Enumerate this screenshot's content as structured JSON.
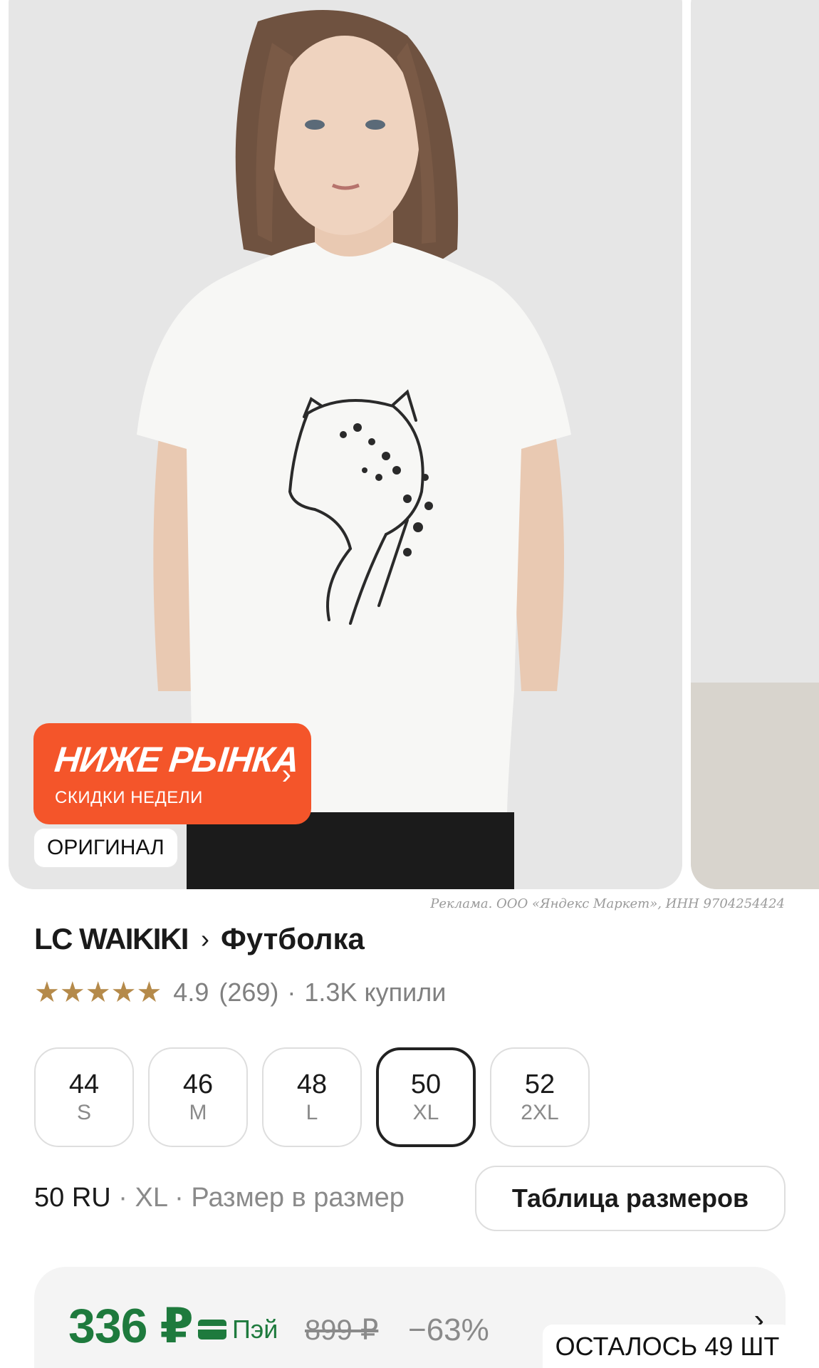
{
  "promo": {
    "title": "НИЖЕ РЫНКА",
    "subtitle": "СКИДКИ НЕДЕЛИ"
  },
  "badge": "ОРИГИНАЛ",
  "ad_disclaimer": "Реклама. ООО «Яндекс Маркет», ИНН 9704254424",
  "breadcrumb": {
    "brand": "LC WAIKIKI",
    "product": "Футболка"
  },
  "rating": {
    "stars": "★★★★★",
    "value": "4.9",
    "reviews": "(269)",
    "separator": "·",
    "bought": "1.3K купили"
  },
  "sizes": [
    {
      "ru": "44",
      "intl": "S",
      "selected": false
    },
    {
      "ru": "46",
      "intl": "M",
      "selected": false
    },
    {
      "ru": "48",
      "intl": "L",
      "selected": false
    },
    {
      "ru": "50",
      "intl": "XL",
      "selected": true
    },
    {
      "ru": "52",
      "intl": "2XL",
      "selected": false
    }
  ],
  "size_info": {
    "selected": "50 RU",
    "intl": "XL",
    "fit": "Размер в размер",
    "dot": "·"
  },
  "size_table_button": "Таблица размеров",
  "price": {
    "current": "336 ₽",
    "pay_label": "Пэй",
    "old": "899 ₽",
    "discount": "−63%",
    "chevron": "›"
  },
  "stock": "ОСТАЛОСЬ 49 ШТ",
  "colors": {
    "promo": "#f4552a",
    "price_green": "#1e7a3d",
    "star": "#b58a4a"
  },
  "icons": {
    "promo_chevron": "chevron-right-icon",
    "crumb_chevron": "chevron-right-icon",
    "card": "card-icon"
  }
}
